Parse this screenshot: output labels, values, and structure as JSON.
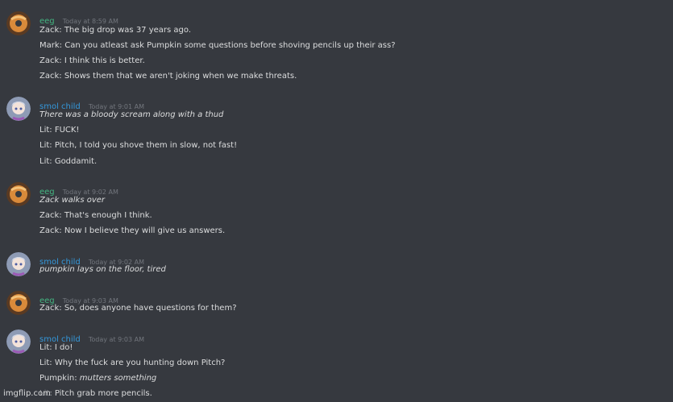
{
  "watermark": "imgflip.com",
  "groups": [
    {
      "user": "eeg",
      "time": "Today at 8:59 AM",
      "avatar": "orange-donut-avatar",
      "lines": [
        {
          "text": "Zack: The big drop was 37 years ago."
        },
        {
          "text": "Mark: Can you atleast ask Pumpkin some questions before shoving pencils up their ass?"
        },
        {
          "text": "Zack: I think this is better."
        },
        {
          "text": "Zack: Shows them that we aren't joking when we make threats."
        }
      ]
    },
    {
      "user": "smol child",
      "time": "Today at 9:01 AM",
      "avatar": "anime-character-avatar",
      "lines": [
        {
          "em": "There was a bloody scream along with a thud"
        },
        {
          "text": "Lit: FUCK!"
        },
        {
          "text": "Lit: Pitch, I told you shove them in slow, not fast!"
        },
        {
          "text": "Lit: Goddamit."
        }
      ]
    },
    {
      "user": "eeg",
      "time": "Today at 9:02 AM",
      "avatar": "orange-donut-avatar",
      "lines": [
        {
          "em": "Zack walks over"
        },
        {
          "text": "Zack: That's enough I think."
        },
        {
          "text": "Zack: Now I believe they will give us answers."
        }
      ]
    },
    {
      "user": "smol child",
      "time": "Today at 9:02 AM",
      "avatar": "anime-character-avatar",
      "lines": [
        {
          "em": "pumpkin lays on the floor, tired"
        }
      ]
    },
    {
      "user": "eeg",
      "time": "Today at 9:03 AM",
      "avatar": "orange-donut-avatar",
      "lines": [
        {
          "text": "Zack: So, does anyone have questions for them?"
        }
      ]
    },
    {
      "user": "smol child",
      "time": "Today at 9:03 AM",
      "avatar": "anime-character-avatar",
      "lines": [
        {
          "text": "Lit: I do!"
        },
        {
          "text": "Lit: Why the fuck are you hunting down Pitch?"
        },
        {
          "text": "Pumpkin: ",
          "em": "mutters something"
        },
        {
          "text": "Lit: Pitch grab more pencils."
        }
      ]
    }
  ]
}
